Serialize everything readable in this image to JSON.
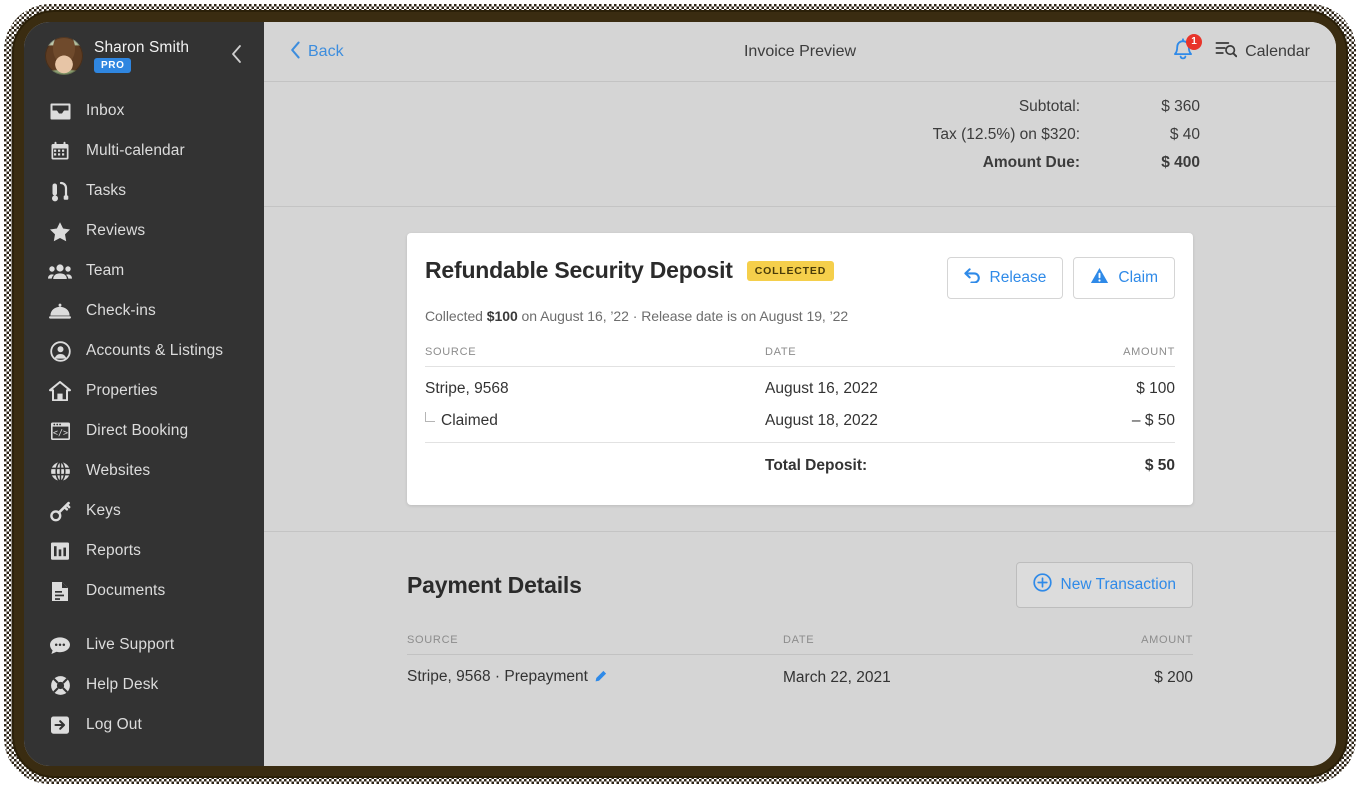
{
  "sidebar": {
    "user": {
      "name": "Sharon Smith",
      "badge": "PRO",
      "avatar_icon": "user-avatar-photo"
    },
    "collapse_icon": "chevron-left-icon",
    "items": [
      {
        "label": "Inbox",
        "icon": "inbox-icon"
      },
      {
        "label": "Multi-calendar",
        "icon": "calendar-grid-icon"
      },
      {
        "label": "Tasks",
        "icon": "vacuum-icon"
      },
      {
        "label": "Reviews",
        "icon": "star-icon"
      },
      {
        "label": "Team",
        "icon": "people-group-icon"
      },
      {
        "label": "Check-ins",
        "icon": "concierge-bell-icon"
      },
      {
        "label": "Accounts & Listings",
        "icon": "user-circle-icon"
      },
      {
        "label": "Properties",
        "icon": "house-icon"
      },
      {
        "label": "Direct Booking",
        "icon": "browser-code-icon"
      },
      {
        "label": "Websites",
        "icon": "globe-icon"
      },
      {
        "label": "Keys",
        "icon": "key-icon"
      },
      {
        "label": "Reports",
        "icon": "bar-chart-icon"
      },
      {
        "label": "Documents",
        "icon": "document-icon"
      }
    ],
    "items_bottom": [
      {
        "label": "Live Support",
        "icon": "chat-bubble-icon"
      },
      {
        "label": "Help Desk",
        "icon": "life-ring-icon"
      },
      {
        "label": "Log Out",
        "icon": "logout-icon"
      }
    ]
  },
  "topbar": {
    "back_label": "Back",
    "back_icon": "chevron-left-icon",
    "title": "Invoice Preview",
    "notifications": {
      "icon": "bell-icon",
      "count": "1"
    },
    "calendar": {
      "label": "Calendar",
      "icon": "list-search-icon"
    }
  },
  "totals": [
    {
      "label": "Subtotal:",
      "value": "$ 360",
      "strong": false
    },
    {
      "label": "Tax (12.5%) on $320:",
      "value": "$ 40",
      "strong": false
    },
    {
      "label": "Amount Due:",
      "value": "$ 400",
      "strong": true
    }
  ],
  "deposit": {
    "title": "Refundable Security Deposit",
    "status_chip": "COLLECTED",
    "subtitle_prefix": "Collected ",
    "subtitle_amount": "$100",
    "subtitle_rest": " on August 16, ’22 · Release date is on August 19, ’22",
    "actions": [
      {
        "label": "Release",
        "icon": "undo-arrow-icon"
      },
      {
        "label": "Claim",
        "icon": "warning-triangle-icon"
      }
    ],
    "columns": {
      "source": "SOURCE",
      "date": "DATE",
      "amount": "AMOUNT"
    },
    "rows": [
      {
        "source": "Stripe, 9568",
        "date": "August 16, 2022",
        "amount": "$ 100",
        "child": false
      },
      {
        "source": "Claimed",
        "date": "August 18, 2022",
        "amount": "– $ 50",
        "child": true
      }
    ],
    "total_label": "Total Deposit:",
    "total_value": "$ 50"
  },
  "payments": {
    "title": "Payment Details",
    "new_transaction": {
      "label": "New Transaction",
      "icon": "plus-circle-icon"
    },
    "columns": {
      "source": "SOURCE",
      "date": "DATE",
      "amount": "AMOUNT"
    },
    "rows": [
      {
        "source": "Stripe, 9568 · Prepayment",
        "date": "March 22, 2021",
        "amount": "$ 200",
        "edit_icon": "pencil-icon"
      }
    ]
  },
  "colors": {
    "accent_blue": "#2f8ae8",
    "badge_blue": "#2f86e0",
    "badge_red": "#e8342a",
    "chip_yellow": "#f5cf4b",
    "sidebar_bg": "#333333",
    "page_bg": "#d5d5d5"
  }
}
